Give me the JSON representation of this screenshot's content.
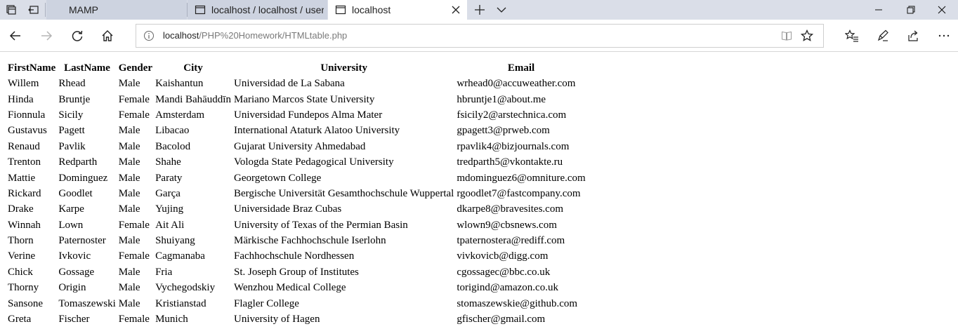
{
  "browser": {
    "tabs": [
      {
        "label": "MAMP",
        "active": false
      },
      {
        "label": "localhost / localhost / user i",
        "active": false
      },
      {
        "label": "localhost",
        "active": true
      }
    ],
    "address": {
      "host": "localhost",
      "path": "/PHP%20Homework/HTMLtable.php"
    }
  },
  "table": {
    "headers": [
      "FirstName",
      "LastName",
      "Gender",
      "City",
      "University",
      "Email"
    ],
    "rows": [
      [
        "Willem",
        "Rhead",
        "Male",
        "Kaishantun",
        "Universidad de La Sabana",
        "wrhead0@accuweather.com"
      ],
      [
        "Hinda",
        "Bruntje",
        "Female",
        "Mandi Bahāuddīn",
        "Mariano Marcos State University",
        "hbruntje1@about.me"
      ],
      [
        "Fionnula",
        "Sicily",
        "Female",
        "Amsterdam",
        "Universidad Fundepos Alma Mater",
        "fsicily2@arstechnica.com"
      ],
      [
        "Gustavus",
        "Pagett",
        "Male",
        "Libacao",
        "International Ataturk Alatoo University",
        "gpagett3@prweb.com"
      ],
      [
        "Renaud",
        "Pavlik",
        "Male",
        "Bacolod",
        "Gujarat University Ahmedabad",
        "rpavlik4@bizjournals.com"
      ],
      [
        "Trenton",
        "Redparth",
        "Male",
        "Shahe",
        "Vologda State Pedagogical University",
        "tredparth5@vkontakte.ru"
      ],
      [
        "Mattie",
        "Dominguez",
        "Male",
        "Paraty",
        "Georgetown College",
        "mdominguez6@omniture.com"
      ],
      [
        "Rickard",
        "Goodlet",
        "Male",
        "Garça",
        "Bergische Universität Gesamthochschule Wuppertal",
        "rgoodlet7@fastcompany.com"
      ],
      [
        "Drake",
        "Karpe",
        "Male",
        "Yujing",
        "Universidade Braz Cubas",
        "dkarpe8@bravesites.com"
      ],
      [
        "Winnah",
        "Lown",
        "Female",
        "Ait Ali",
        "University of Texas of the Permian Basin",
        "wlown9@cbsnews.com"
      ],
      [
        "Thorn",
        "Paternoster",
        "Male",
        "Shuiyang",
        "Märkische Fachhochschule Iserlohn",
        "tpaternostera@rediff.com"
      ],
      [
        "Verine",
        "Ivkovic",
        "Female",
        "Cagmanaba",
        "Fachhochschule Nordhessen",
        "vivkovicb@digg.com"
      ],
      [
        "Chick",
        "Gossage",
        "Male",
        "Fria",
        "St. Joseph Group of Institutes",
        "cgossagec@bbc.co.uk"
      ],
      [
        "Thorny",
        "Origin",
        "Male",
        "Vychegodskiy",
        "Wenzhou Medical College",
        "torigind@amazon.co.uk"
      ],
      [
        "Sansone",
        "Tomaszewski",
        "Male",
        "Kristianstad",
        "Flagler College",
        "stomaszewskie@github.com"
      ],
      [
        "Greta",
        "Fischer",
        "Female",
        "Munich",
        "University of Hagen",
        "gfischer@gmail.com"
      ]
    ]
  },
  "icons": {
    "tab_set_aside": "tabs-aside-icon",
    "tab_restore": "restore-tabs-icon",
    "page": "page-icon",
    "close": "close-icon",
    "new_tab": "plus-icon",
    "tab_list": "chevron-down-icon",
    "back": "back-arrow-icon",
    "forward": "forward-arrow-icon",
    "refresh": "refresh-icon",
    "home": "home-icon",
    "info": "info-icon",
    "reading_view": "reading-view-icon",
    "favorite": "star-icon",
    "favorites_hub": "favorites-hub-icon",
    "notes": "pen-icon",
    "share": "share-icon",
    "more": "more-icon"
  },
  "colors": {
    "tabbar_bg": "#dadee8",
    "active_tab_bg": "#ffffff",
    "url_path": "#7a7a7a"
  }
}
